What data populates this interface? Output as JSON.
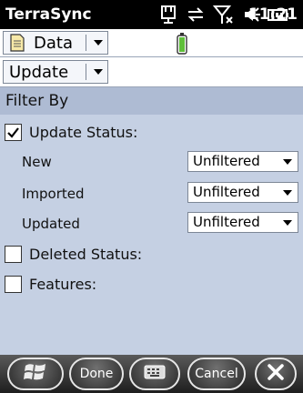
{
  "statusbar": {
    "app_title": "TerraSync",
    "time": "11:21",
    "icons": [
      "connectivity-icon",
      "sync-icon",
      "no-signal-icon",
      "speaker-icon",
      "battery-icon"
    ]
  },
  "toolbar": {
    "section_menu": "Data",
    "subsection_menu": "Update"
  },
  "filter": {
    "header": "Filter By",
    "update_status": {
      "label": "Update Status:",
      "checked": true
    },
    "rows": [
      {
        "label": "New",
        "value": "Unfiltered"
      },
      {
        "label": "Imported",
        "value": "Unfiltered"
      },
      {
        "label": "Updated",
        "value": "Unfiltered"
      }
    ],
    "deleted_status": {
      "label": "Deleted Status:",
      "checked": false
    },
    "features": {
      "label": "Features:",
      "checked": false
    }
  },
  "bottombar": {
    "done_label": "Done",
    "cancel_label": "Cancel"
  },
  "colors": {
    "panel_bg": "#c5d0e3",
    "header_bg": "#aebbd3",
    "status_bg": "#000000"
  }
}
